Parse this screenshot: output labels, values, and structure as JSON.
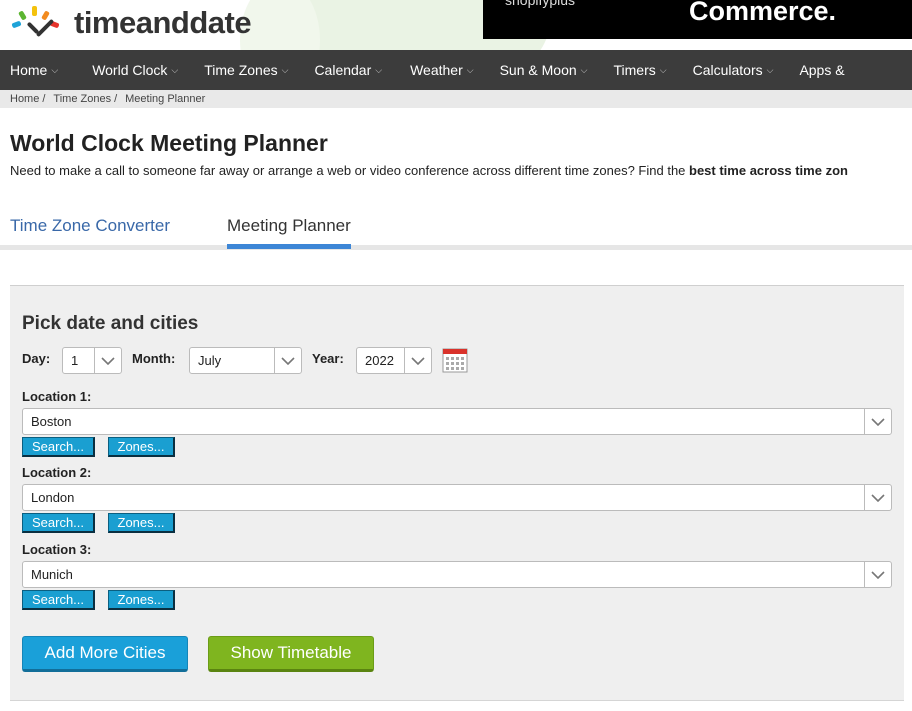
{
  "header": {
    "logo_text": "timeanddate",
    "ad_small": "shopifyplus",
    "ad_big": "Commerce."
  },
  "nav": {
    "items": [
      {
        "label": "Home"
      },
      {
        "label": "World Clock"
      },
      {
        "label": "Time Zones"
      },
      {
        "label": "Calendar"
      },
      {
        "label": "Weather"
      },
      {
        "label": "Sun & Moon"
      },
      {
        "label": "Timers"
      },
      {
        "label": "Calculators"
      },
      {
        "label": "Apps &"
      }
    ]
  },
  "breadcrumb": {
    "home": "Home",
    "time_zones": "Time Zones",
    "current": "Meeting Planner",
    "separator": "/"
  },
  "page": {
    "title": "World Clock Meeting Planner",
    "intro_start": "Need to make a call to someone far away or arrange a web or video conference across different time zones? Find the ",
    "intro_bold": "best time across time zon"
  },
  "tabs": {
    "converter": "Time Zone Converter",
    "planner": "Meeting Planner"
  },
  "form": {
    "heading": "Pick date and cities",
    "day_label": "Day:",
    "day_value": "1",
    "month_label": "Month:",
    "month_value": "July",
    "year_label": "Year:",
    "year_value": "2022",
    "locations": [
      {
        "label": "Location 1:",
        "value": "Boston"
      },
      {
        "label": "Location 2:",
        "value": "London"
      },
      {
        "label": "Location 3:",
        "value": "Munich"
      }
    ],
    "search_label": "Search...",
    "zones_label": "Zones...",
    "add_more_label": "Add More Cities",
    "show_timetable_label": "Show Timetable"
  },
  "colors": {
    "nav_bg": "#3c3c3c",
    "link_blue": "#3968a8",
    "button_blue": "#1aa0d9",
    "button_green": "#7fb51f"
  }
}
